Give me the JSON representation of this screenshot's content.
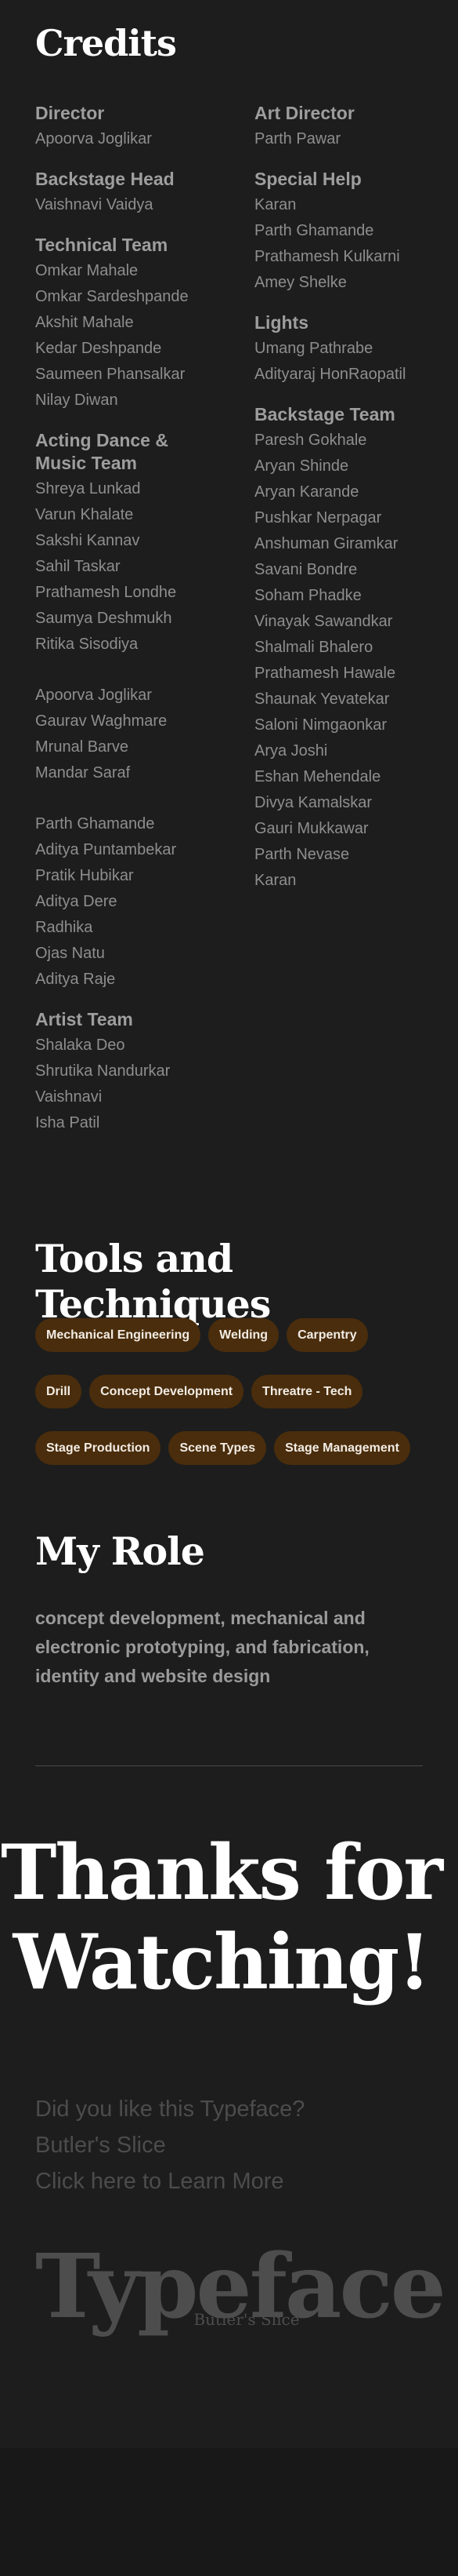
{
  "credits": {
    "title": "Credits",
    "left_column": [
      {
        "role": "Director",
        "names": [
          "Apoorva Joglikar"
        ]
      },
      {
        "role": "Backstage Head",
        "names": [
          "Vaishnavi Vaidya"
        ]
      },
      {
        "role": "Technical Team",
        "names": [
          "Omkar Mahale",
          "Omkar Sardeshpande",
          "Akshit Mahale",
          "Kedar Deshpande",
          "Saumeen Phansalkar",
          "Nilay Diwan"
        ]
      },
      {
        "role": "Acting Dance & Music Team",
        "names": [
          "Shreya Lunkad",
          "Varun Khalate",
          "Sakshi Kannav",
          "Sahil Taskar",
          "Prathamesh Londhe",
          "Saumya Deshmukh",
          "Ritika Sisodiya"
        ],
        "names_2": [
          "Apoorva Joglikar",
          "Gaurav Waghmare",
          "Mrunal Barve",
          "Mandar Saraf"
        ],
        "names_3": [
          "Parth Ghamande",
          "Aditya Puntambekar",
          "Pratik Hubikar",
          "Aditya Dere",
          "Radhika",
          "Ojas Natu",
          "Aditya Raje"
        ]
      },
      {
        "role": "Artist Team",
        "names": [
          "Shalaka Deo",
          "Shrutika Nandurkar",
          "Vaishnavi",
          "Isha Patil"
        ]
      }
    ],
    "right_column": [
      {
        "role": "Art Director",
        "names": [
          "Parth Pawar"
        ]
      },
      {
        "role": "Special Help",
        "names": [
          "Karan",
          "Parth Ghamande",
          "Prathamesh Kulkarni",
          "Amey Shelke"
        ]
      },
      {
        "role": "Lights",
        "names": [
          "Umang Pathrabe",
          "Adityaraj HonRaopatil"
        ]
      },
      {
        "role": "Backstage Team",
        "names": [
          "Paresh Gokhale",
          "Aryan Shinde",
          "Aryan Karande",
          "Pushkar Nerpagar",
          "Anshuman Giramkar",
          "Savani Bondre",
          "Soham Phadke",
          "Vinayak Sawandkar",
          "Shalmali Bhalero",
          "Prathamesh Hawale",
          "Shaunak Yevatekar",
          "Saloni Nimgaonkar",
          "Arya Joshi",
          "Eshan Mehendale",
          "Divya Kamalskar",
          "Gauri Mukkawar",
          "Parth Nevase",
          "Karan"
        ]
      }
    ]
  },
  "tools": {
    "title": "Tools and Techniques",
    "rows": [
      [
        "Mechanical Engineering",
        "Welding",
        "Carpentry"
      ],
      [
        "Drill",
        "Concept Development",
        "Threatre - Tech"
      ],
      [
        "Stage Production",
        "Scene Types",
        "Stage Management"
      ]
    ]
  },
  "my_role": {
    "title": "My Role",
    "text": "concept development, mechanical and electronic prototyping, and fabrication, identity and website design"
  },
  "thanks": {
    "line1": "Thanks for",
    "line2": "Watching!"
  },
  "promo": {
    "line1": "Did you like this Typeface?",
    "line2": "Butler's Slice",
    "link": "Click here to Learn More"
  },
  "wordmark": {
    "main": "Typeface",
    "sub": "Butler's Slice"
  },
  "colors": {
    "background": "#1d1d1d",
    "tag_bg": "#4a2d0c",
    "heading": "#ffffff",
    "muted": "#4c4c4c"
  }
}
